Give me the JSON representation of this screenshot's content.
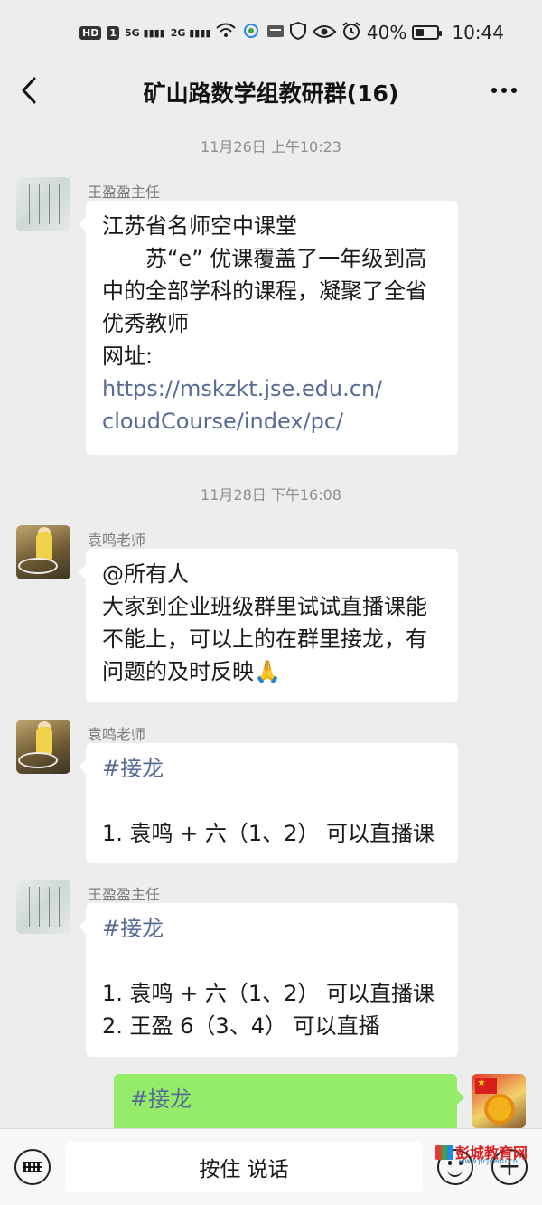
{
  "status_bar": {
    "left_indicators": [
      "HD",
      "1",
      "5G",
      "2G"
    ],
    "right_percent": "40%",
    "time": "10:44",
    "battery_level": 0.4
  },
  "header": {
    "title": "矿山路数学组教研群(16)"
  },
  "messages": [
    {
      "type": "timestamp",
      "text": "11月26日 上午10:23"
    },
    {
      "type": "message",
      "sender": "王盈盈主任",
      "avatar": "calligraphy-avatar",
      "lines": [
        "江苏省名师空中课堂",
        "　　苏“e” 优课覆盖了一年级到高",
        "中的全部学科的课程，凝聚了全省",
        "优秀教师",
        "网址:"
      ],
      "link_lines": [
        "https://mskzkt.jse.edu.cn/",
        "cloudCourse/index/pc/"
      ]
    },
    {
      "type": "timestamp",
      "text": "11月28日 下午16:08"
    },
    {
      "type": "message",
      "sender": "袁鸣老师",
      "avatar": "child-photo-avatar",
      "lines": [
        "@所有人",
        "大家到企业班级群里试试直播课能",
        "不能上，可以上的在群里接龙，有",
        "问题的及时反映🙏"
      ]
    },
    {
      "type": "message",
      "sender": "袁鸣老师",
      "avatar": "child-photo-avatar",
      "tag": "#接龙",
      "lines": [
        "1. 袁鸣 + 六（1、2） 可以直播课"
      ]
    },
    {
      "type": "message",
      "sender": "王盈盈主任",
      "avatar": "calligraphy-avatar",
      "tag": "#接龙",
      "lines": [
        "1. 袁鸣 + 六（1、2） 可以直播课",
        "2. 王盈 6（3、4） 可以直播"
      ]
    },
    {
      "type": "self_message",
      "avatar": "self-flower-avatar",
      "tag": "#接龙"
    }
  ],
  "input_bar": {
    "hold_to_talk": "按住 说话"
  },
  "watermark": {
    "name": "彭城教育网",
    "url": "www.pcjyedu.cn"
  },
  "colors": {
    "background": "#ededed",
    "self_bubble": "#95ec69",
    "link": "#576b95",
    "timestamp": "#8f8f8f"
  }
}
